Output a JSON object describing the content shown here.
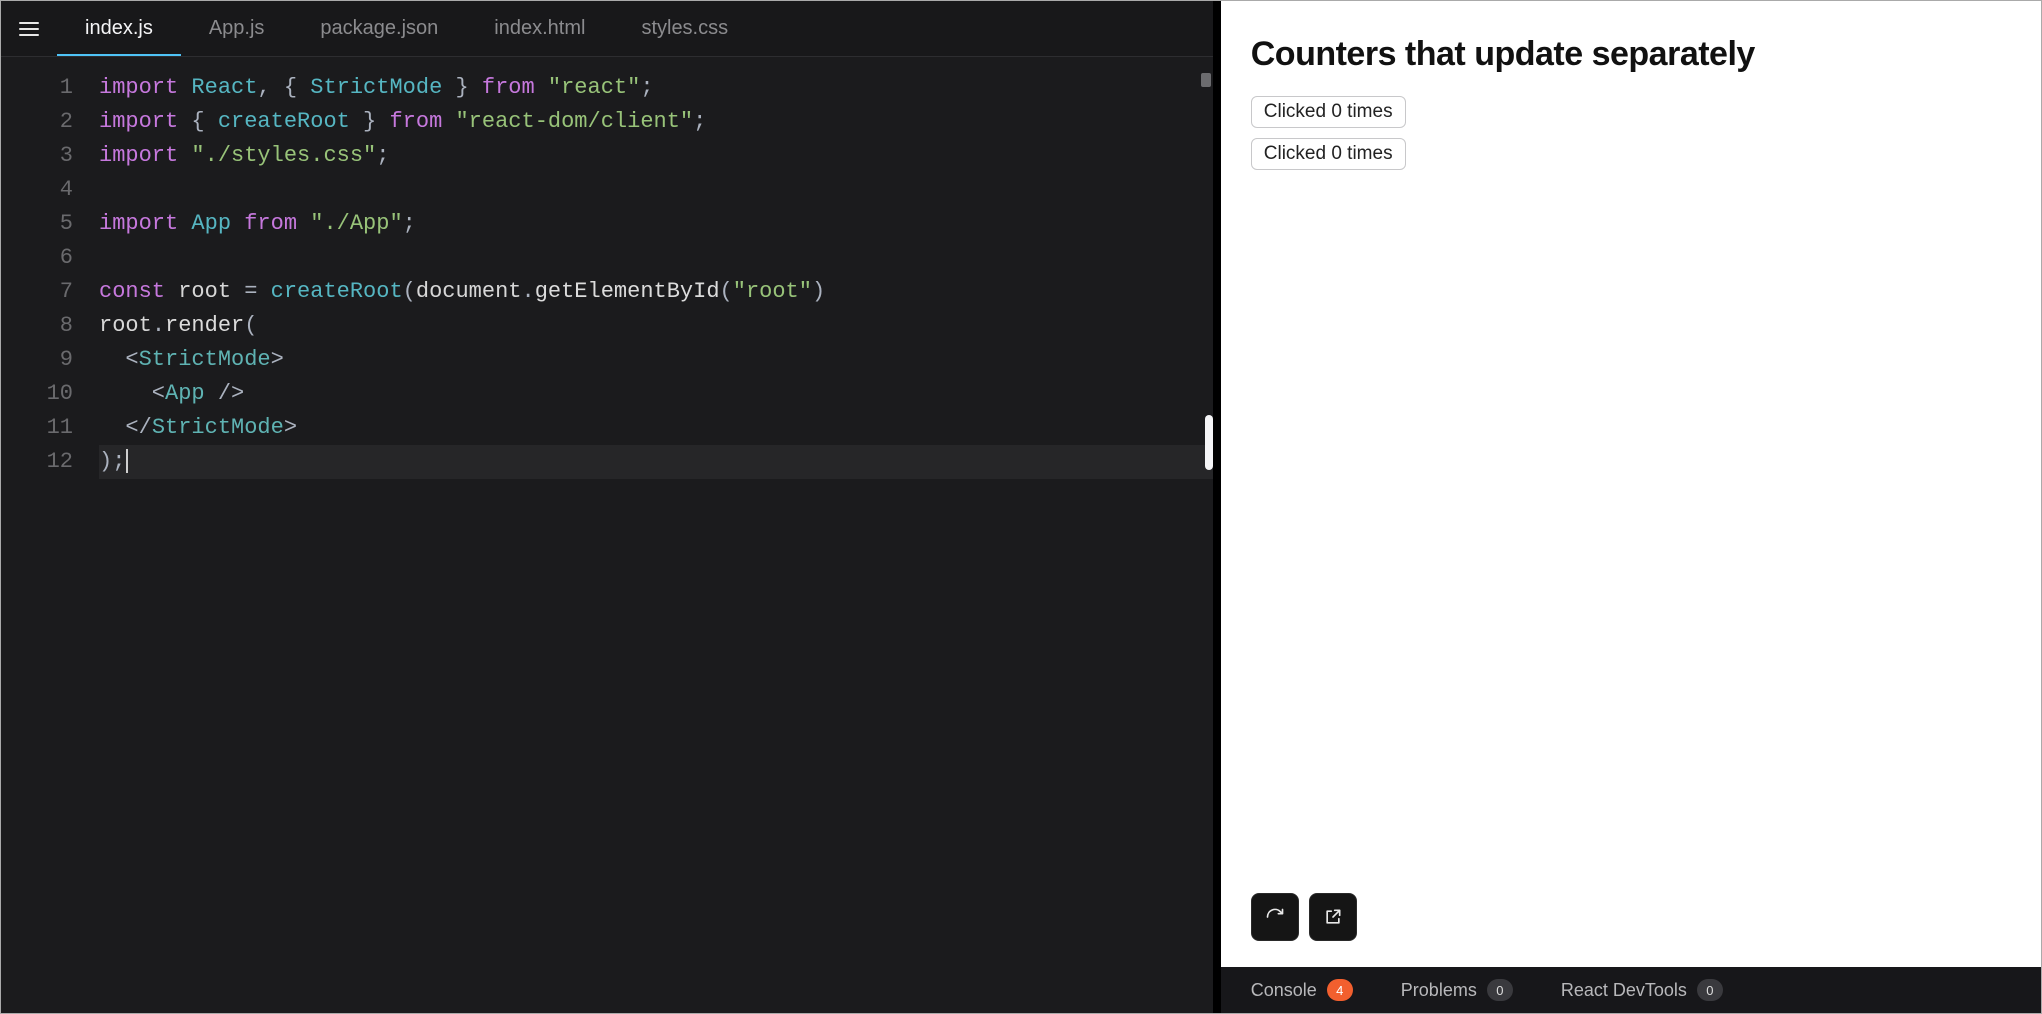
{
  "tabs": [
    "index.js",
    "App.js",
    "package.json",
    "index.html",
    "styles.css"
  ],
  "active_tab": "index.js",
  "cursor_line": 12,
  "code_lines": [
    [
      {
        "t": "import ",
        "c": "tk-kw"
      },
      {
        "t": "React",
        "c": "tk-id"
      },
      {
        "t": ", { ",
        "c": "tk-op"
      },
      {
        "t": "StrictMode",
        "c": "tk-id"
      },
      {
        "t": " } ",
        "c": "tk-op"
      },
      {
        "t": "from ",
        "c": "tk-kw"
      },
      {
        "t": "\"react\"",
        "c": "tk-str"
      },
      {
        "t": ";",
        "c": "tk-op"
      }
    ],
    [
      {
        "t": "import ",
        "c": "tk-kw"
      },
      {
        "t": "{ ",
        "c": "tk-op"
      },
      {
        "t": "createRoot",
        "c": "tk-id"
      },
      {
        "t": " } ",
        "c": "tk-op"
      },
      {
        "t": "from ",
        "c": "tk-kw"
      },
      {
        "t": "\"react-dom/client\"",
        "c": "tk-str"
      },
      {
        "t": ";",
        "c": "tk-op"
      }
    ],
    [
      {
        "t": "import ",
        "c": "tk-kw"
      },
      {
        "t": "\"./styles.css\"",
        "c": "tk-str"
      },
      {
        "t": ";",
        "c": "tk-op"
      }
    ],
    [
      {
        "t": "",
        "c": "tk-def"
      }
    ],
    [
      {
        "t": "import ",
        "c": "tk-kw"
      },
      {
        "t": "App",
        "c": "tk-id"
      },
      {
        "t": " ",
        "c": "tk-op"
      },
      {
        "t": "from ",
        "c": "tk-kw"
      },
      {
        "t": "\"./App\"",
        "c": "tk-str"
      },
      {
        "t": ";",
        "c": "tk-op"
      }
    ],
    [
      {
        "t": "",
        "c": "tk-def"
      }
    ],
    [
      {
        "t": "const ",
        "c": "tk-kw"
      },
      {
        "t": "root",
        "c": "tk-def"
      },
      {
        "t": " = ",
        "c": "tk-op"
      },
      {
        "t": "createRoot",
        "c": "tk-id"
      },
      {
        "t": "(",
        "c": "tk-op"
      },
      {
        "t": "document",
        "c": "tk-def"
      },
      {
        "t": ".",
        "c": "tk-op"
      },
      {
        "t": "getElementById",
        "c": "tk-call"
      },
      {
        "t": "(",
        "c": "tk-op"
      },
      {
        "t": "\"root\"",
        "c": "tk-str"
      },
      {
        "t": ")",
        "c": "tk-op"
      }
    ],
    [
      {
        "t": "root",
        "c": "tk-def"
      },
      {
        "t": ".",
        "c": "tk-op"
      },
      {
        "t": "render",
        "c": "tk-call"
      },
      {
        "t": "(",
        "c": "tk-op"
      }
    ],
    [
      {
        "t": "  <",
        "c": "tk-op"
      },
      {
        "t": "StrictMode",
        "c": "tk-tag"
      },
      {
        "t": ">",
        "c": "tk-op"
      }
    ],
    [
      {
        "t": "    <",
        "c": "tk-op"
      },
      {
        "t": "App",
        "c": "tk-tag"
      },
      {
        "t": " />",
        "c": "tk-op"
      }
    ],
    [
      {
        "t": "  </",
        "c": "tk-op"
      },
      {
        "t": "StrictMode",
        "c": "tk-tag"
      },
      {
        "t": ">",
        "c": "tk-op"
      }
    ],
    [
      {
        "t": ");",
        "c": "tk-op"
      }
    ]
  ],
  "preview": {
    "heading": "Counters that update separately",
    "buttons": [
      "Clicked 0 times",
      "Clicked 0 times"
    ]
  },
  "bottom_tabs": [
    {
      "label": "Console",
      "count": "4",
      "warn": true
    },
    {
      "label": "Problems",
      "count": "0",
      "warn": false
    },
    {
      "label": "React DevTools",
      "count": "0",
      "warn": false
    }
  ]
}
